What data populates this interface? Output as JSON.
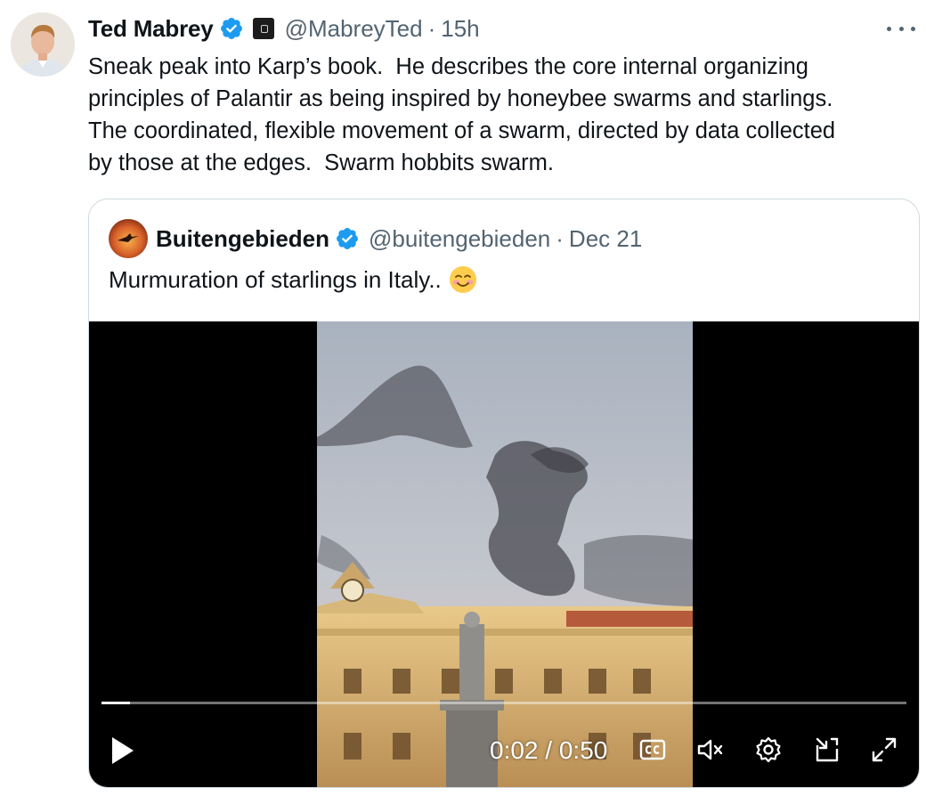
{
  "tweet": {
    "display_name": "Ted Mabrey",
    "handle": "@MabreyTed",
    "separator": "·",
    "time": "15h",
    "text": "Sneak peak into Karp’s book.  He describes the core internal organizing\nprinciples of Palantir as being inspired by honeybee swarms and starlings.\nThe coordinated, flexible movement of a swarm, directed by data collected\nby those at the edges.  Swarm hobbits swarm."
  },
  "quote": {
    "display_name": "Buitengebieden",
    "handle": "@buitengebieden",
    "separator": "·",
    "date": "Dec 21",
    "text": "Murmuration of starlings in Italy.."
  },
  "video": {
    "current_time": "0:02",
    "time_separator": "/",
    "duration": "0:50",
    "progress_fraction": 0.035
  },
  "icons": {
    "verified": "verified-badge-icon",
    "affiliation": "affiliation-badge-icon",
    "more": "more-dots-icon",
    "play": "play-icon",
    "captions": "captions-icon",
    "mute": "muted-speaker-icon",
    "settings": "gear-icon",
    "pip": "picture-in-picture-icon",
    "fullscreen": "fullscreen-icon"
  },
  "colors": {
    "verified_blue": "#1d9bf0",
    "secondary_text": "#536471",
    "border": "#cfd9de"
  }
}
